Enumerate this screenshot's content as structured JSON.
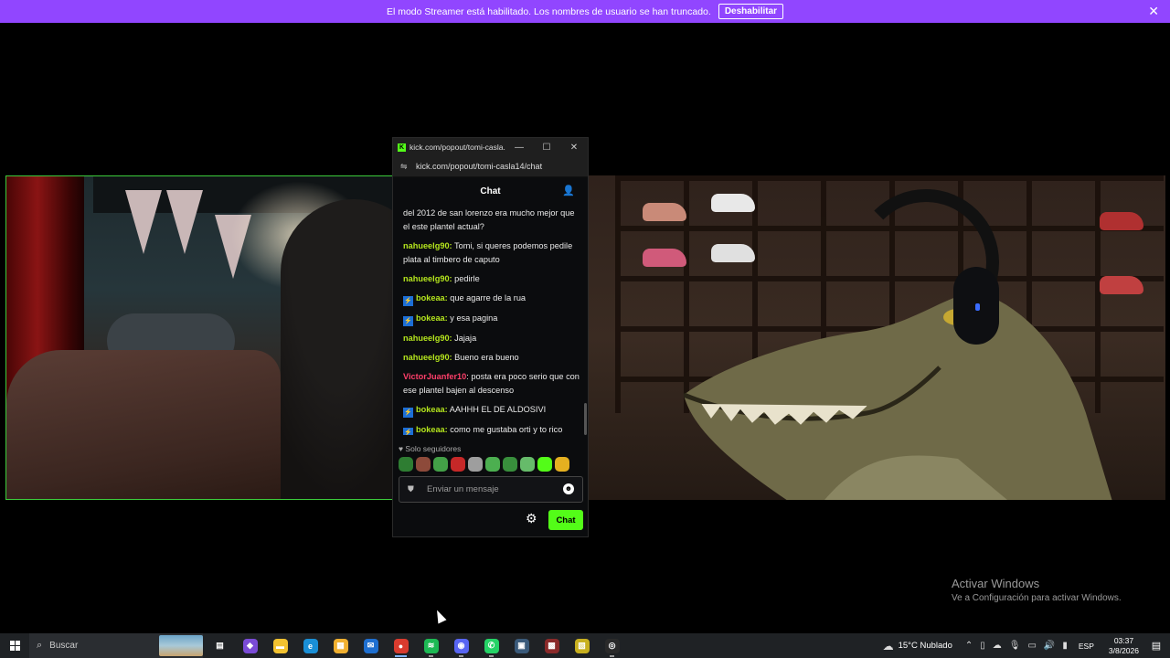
{
  "banner": {
    "text": "El modo Streamer está habilitado. Los nombres de usuario se han truncado.",
    "button": "Deshabilitar",
    "bg": "#9146ff"
  },
  "popout": {
    "title": "kick.com/popout/tomi-casla...",
    "url": "kick.com/popout/tomi-casla14/chat",
    "header": "Chat",
    "messages": [
      {
        "user": "",
        "text": "del 2012 de san lorenzo era mucho mejor que el este plantel actual?",
        "color": "#ffffff",
        "badge": false
      },
      {
        "user": "nahueelg90:",
        "text": "Tomi, si queres podemos pedile plata al timbero de caputo",
        "color": "#b5e61d",
        "badge": false
      },
      {
        "user": "nahueelg90:",
        "text": "pedirle",
        "color": "#b5e61d",
        "badge": false
      },
      {
        "user": "bokeaa:",
        "text": "que agarre de la rua",
        "color": "#b5e61d",
        "badge": true
      },
      {
        "user": "bokeaa:",
        "text": "y esa pagina",
        "color": "#b5e61d",
        "badge": true
      },
      {
        "user": "nahueelg90:",
        "text": "Jajaja",
        "color": "#b5e61d",
        "badge": false
      },
      {
        "user": "nahueelg90:",
        "text": "Bueno era bueno",
        "color": "#b5e61d",
        "badge": false
      },
      {
        "user": "VictorJuanfer10",
        "text": ": posta era poco serio que con ese plantel bajen al descenso",
        "color": "#ff3f6a",
        "badge": false
      },
      {
        "user": "bokeaa:",
        "text": "AAHHH EL DE ALDOSIVI",
        "color": "#b5e61d",
        "badge": true
      },
      {
        "user": "bokeaa:",
        "text": "como me gustaba orti y to rico",
        "color": "#b5e61d",
        "badge": true
      }
    ],
    "followers_only": "Solo seguidores",
    "input_placeholder": "Enviar un mensaje",
    "send_button": "Chat",
    "accent": "#53fc18"
  },
  "watermark": {
    "line1": "Activar Windows",
    "line2": "Ve a Configuración para activar Windows."
  },
  "taskbar": {
    "search_label": "Buscar",
    "apps": [
      {
        "name": "task-view-icon",
        "glyph": "▤",
        "bg": "transparent",
        "state": ""
      },
      {
        "name": "copilot-icon",
        "glyph": "◆",
        "bg": "#7a4bd6",
        "state": ""
      },
      {
        "name": "file-explorer-icon",
        "glyph": "▬",
        "bg": "#f2c230",
        "state": ""
      },
      {
        "name": "edge-icon",
        "glyph": "e",
        "bg": "#1a8fd6",
        "state": ""
      },
      {
        "name": "store-icon",
        "glyph": "▦",
        "bg": "#f0b030",
        "state": ""
      },
      {
        "name": "mail-icon",
        "glyph": "✉",
        "bg": "#1e6fd0",
        "state": ""
      },
      {
        "name": "chrome-icon",
        "glyph": "●",
        "bg": "#d93b2e",
        "state": "active"
      },
      {
        "name": "spotify-icon",
        "glyph": "≋",
        "bg": "#1db954",
        "state": "running"
      },
      {
        "name": "discord-icon",
        "glyph": "◉",
        "bg": "#5865f2",
        "state": "running"
      },
      {
        "name": "whatsapp-icon",
        "glyph": "✆",
        "bg": "#25d366",
        "state": "running"
      },
      {
        "name": "media-app-icon",
        "glyph": "▣",
        "bg": "#3a5a7a",
        "state": ""
      },
      {
        "name": "game-app-icon",
        "glyph": "▩",
        "bg": "#8a2a2a",
        "state": ""
      },
      {
        "name": "notes-app-icon",
        "glyph": "▧",
        "bg": "#c8b020",
        "state": ""
      },
      {
        "name": "obs-icon",
        "glyph": "◎",
        "bg": "#2a2a2a",
        "state": "running"
      }
    ],
    "weather": "15°C  Nublado",
    "lang": "ESP",
    "time": "03:37",
    "date": "3/8/2026"
  }
}
